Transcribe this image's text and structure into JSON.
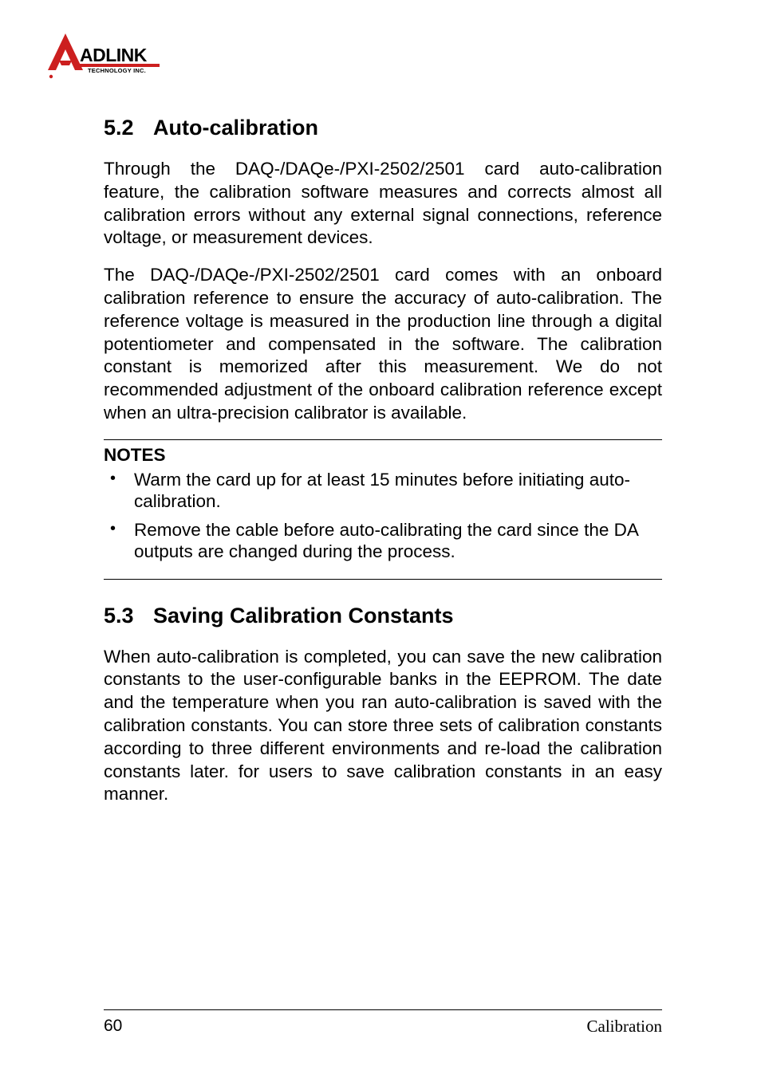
{
  "logo": {
    "brand_top": "ADLINK",
    "brand_sub": "TECHNOLOGY INC."
  },
  "sections": [
    {
      "number": "5.2",
      "title": "Auto-calibration",
      "paragraphs": [
        "Through the DAQ-/DAQe-/PXI-2502/2501 card auto-calibration feature, the calibration software measures and corrects almost all calibration errors without any external signal connections, reference voltage, or measurement devices.",
        "The DAQ-/DAQe-/PXI-2502/2501 card comes with an onboard calibration reference to ensure the accuracy of auto-calibration. The reference voltage is measured in the production line through a digital potentiometer and compensated in the software. The calibration constant is memorized after this measurement. We do not recommended adjustment of the onboard calibration reference except when an ultra-precision calibrator is available."
      ]
    },
    {
      "number": "5.3",
      "title": "Saving Calibration Constants",
      "paragraphs": [
        "When auto-calibration is completed, you can save the new calibration constants to the user-configurable banks in the EEPROM. The date and the temperature when you ran auto-calibration is saved with the calibration constants. You can store three sets of calibration constants according to three different environments and re-load the calibration constants later. for users to save calibration constants in an easy manner."
      ]
    }
  ],
  "notes": {
    "label": "NOTES",
    "items": [
      "Warm the card up for at least 15 minutes before initiating auto-calibration.",
      "Remove the cable before auto-calibrating the card since the DA outputs are changed during the process."
    ]
  },
  "footer": {
    "page": "60",
    "label": "Calibration"
  }
}
